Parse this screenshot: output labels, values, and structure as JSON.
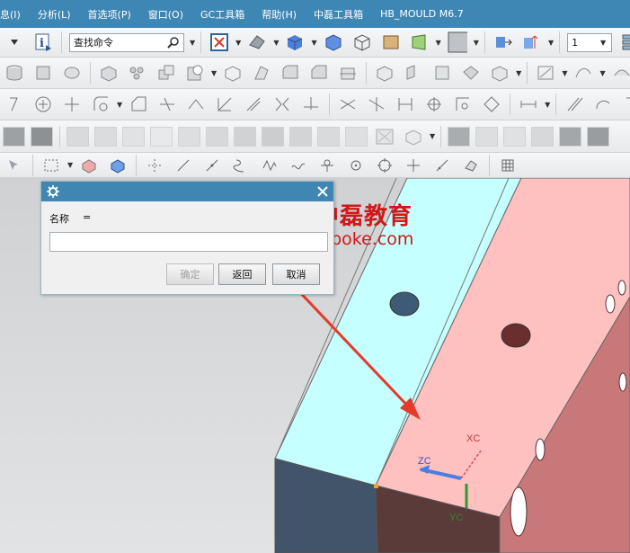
{
  "menu": {
    "items": [
      "息(I)",
      "分析(L)",
      "首选项(P)",
      "窗口(O)",
      "GC工具箱",
      "帮助(H)",
      "中磊工具箱",
      "HB_MOULD M6.7"
    ]
  },
  "toolbar": {
    "search_placeholder": "查找命令",
    "layer_value": "1"
  },
  "dialog": {
    "label": "名称",
    "equals": "=",
    "input_value": "",
    "ok_label": "确定",
    "back_label": "返回",
    "cancel_label": "取消"
  },
  "watermark": {
    "brand": "中磊教育",
    "url": "ugboke.com"
  },
  "axes": {
    "xc": "XC",
    "yc": "YC",
    "zc": "ZC"
  },
  "colors": {
    "menubar": "#3e86b4",
    "face_top": "#c6ffff",
    "face_pink": "#ffc0c0",
    "face_side": "#c97878",
    "face_dark": "#5a3a3a",
    "face_steel": "#3f5266",
    "arrow": "#e43a2a",
    "watermark": "#d01818"
  }
}
